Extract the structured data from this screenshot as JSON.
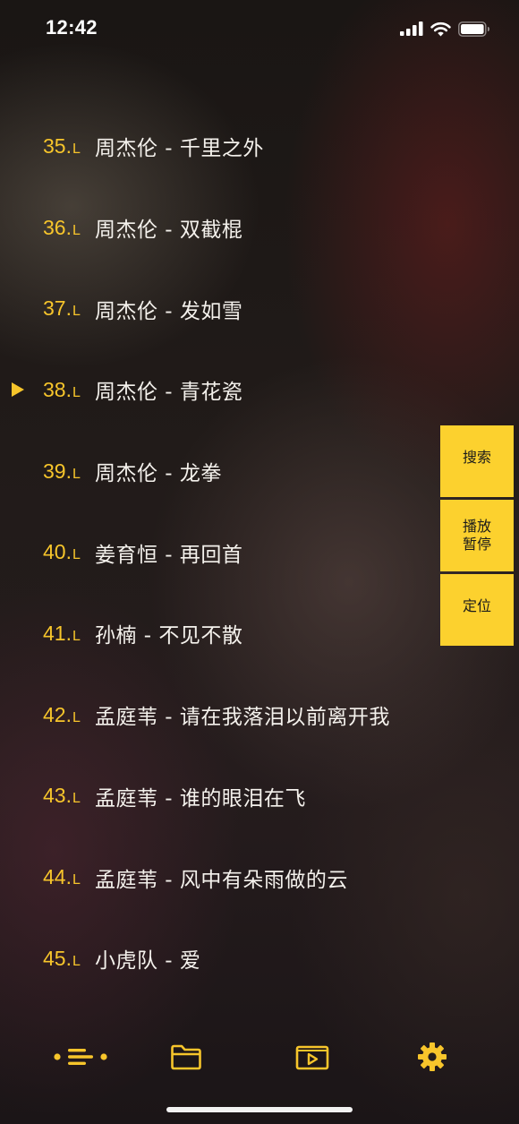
{
  "status_bar": {
    "time": "12:42"
  },
  "songs": [
    {
      "num": "35.",
      "suffix": "L",
      "title": "周杰伦 - 千里之外",
      "playing": false
    },
    {
      "num": "36.",
      "suffix": "L",
      "title": "周杰伦 - 双截棍",
      "playing": false
    },
    {
      "num": "37.",
      "suffix": "L",
      "title": "周杰伦 - 发如雪",
      "playing": false
    },
    {
      "num": "38.",
      "suffix": "L",
      "title": "周杰伦 - 青花瓷",
      "playing": true
    },
    {
      "num": "39.",
      "suffix": "L",
      "title": "周杰伦 - 龙拳",
      "playing": false
    },
    {
      "num": "40.",
      "suffix": "L",
      "title": "姜育恒 - 再回首",
      "playing": false
    },
    {
      "num": "41.",
      "suffix": "L",
      "title": "孙楠 - 不见不散",
      "playing": false
    },
    {
      "num": "42.",
      "suffix": "L",
      "title": "孟庭苇 - 请在我落泪以前离开我",
      "playing": false
    },
    {
      "num": "43.",
      "suffix": "L",
      "title": "孟庭苇 - 谁的眼泪在飞",
      "playing": false
    },
    {
      "num": "44.",
      "suffix": "L",
      "title": "孟庭苇 - 风中有朵雨做的云",
      "playing": false
    },
    {
      "num": "45.",
      "suffix": "L",
      "title": "小虎队 - 爱",
      "playing": false
    }
  ],
  "side_panel": {
    "search_label": "搜索",
    "play_pause_line1": "播放",
    "play_pause_line2": "暂停",
    "locate_label": "定位"
  },
  "tab_bar": {
    "icons": [
      "playlist-icon",
      "folder-icon",
      "video-play-icon",
      "settings-gear-icon"
    ]
  },
  "colors": {
    "accent": "#f7c52b",
    "panel_button": "#fcd12e",
    "text": "#f4f1ec"
  }
}
